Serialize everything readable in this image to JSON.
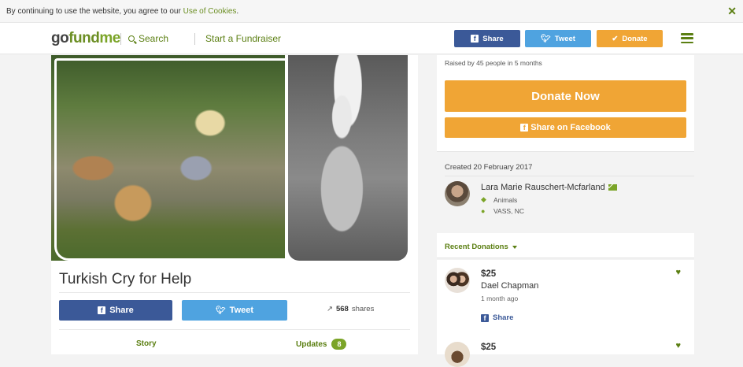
{
  "cookie_bar": {
    "text": "By continuing to use the website, you agree to our ",
    "link": "Use of Cookies",
    "end": ".",
    "close_icon": "close-icon"
  },
  "header": {
    "logo": {
      "go": "go",
      "fund": "fund",
      "me": "me"
    },
    "search_label": "Search",
    "start_label": "Start a Fundraiser",
    "share_label": "Share",
    "tweet_label": "Tweet",
    "donate_label": "Donate",
    "colors": {
      "facebook": "#3b5998",
      "twitter": "#4fa3e0",
      "donate": "#f0a535",
      "brand": "#5b7f12"
    }
  },
  "campaign": {
    "title": "Turkish Cry for Help",
    "share_label": "Share",
    "tweet_label": "Tweet",
    "share_count": "568",
    "share_suffix": "shares",
    "tabs": {
      "story": "Story",
      "updates": "Updates",
      "updates_count": "8"
    }
  },
  "donate_card": {
    "raised_text": "Raised by 45 people in 5 months",
    "donate_now": "Donate Now",
    "share_facebook": "Share on Facebook"
  },
  "organizer": {
    "created": "Created 20 February 2017",
    "name": "Lara Marie Rauschert-Mcfarland",
    "category": "Animals",
    "location": "VASS, NC"
  },
  "recent": {
    "label": "Recent Donations",
    "donations": [
      {
        "amount": "$25",
        "name": "Dael Chapman",
        "time": "1 month ago",
        "share": "Share"
      },
      {
        "amount": "$25"
      }
    ]
  }
}
